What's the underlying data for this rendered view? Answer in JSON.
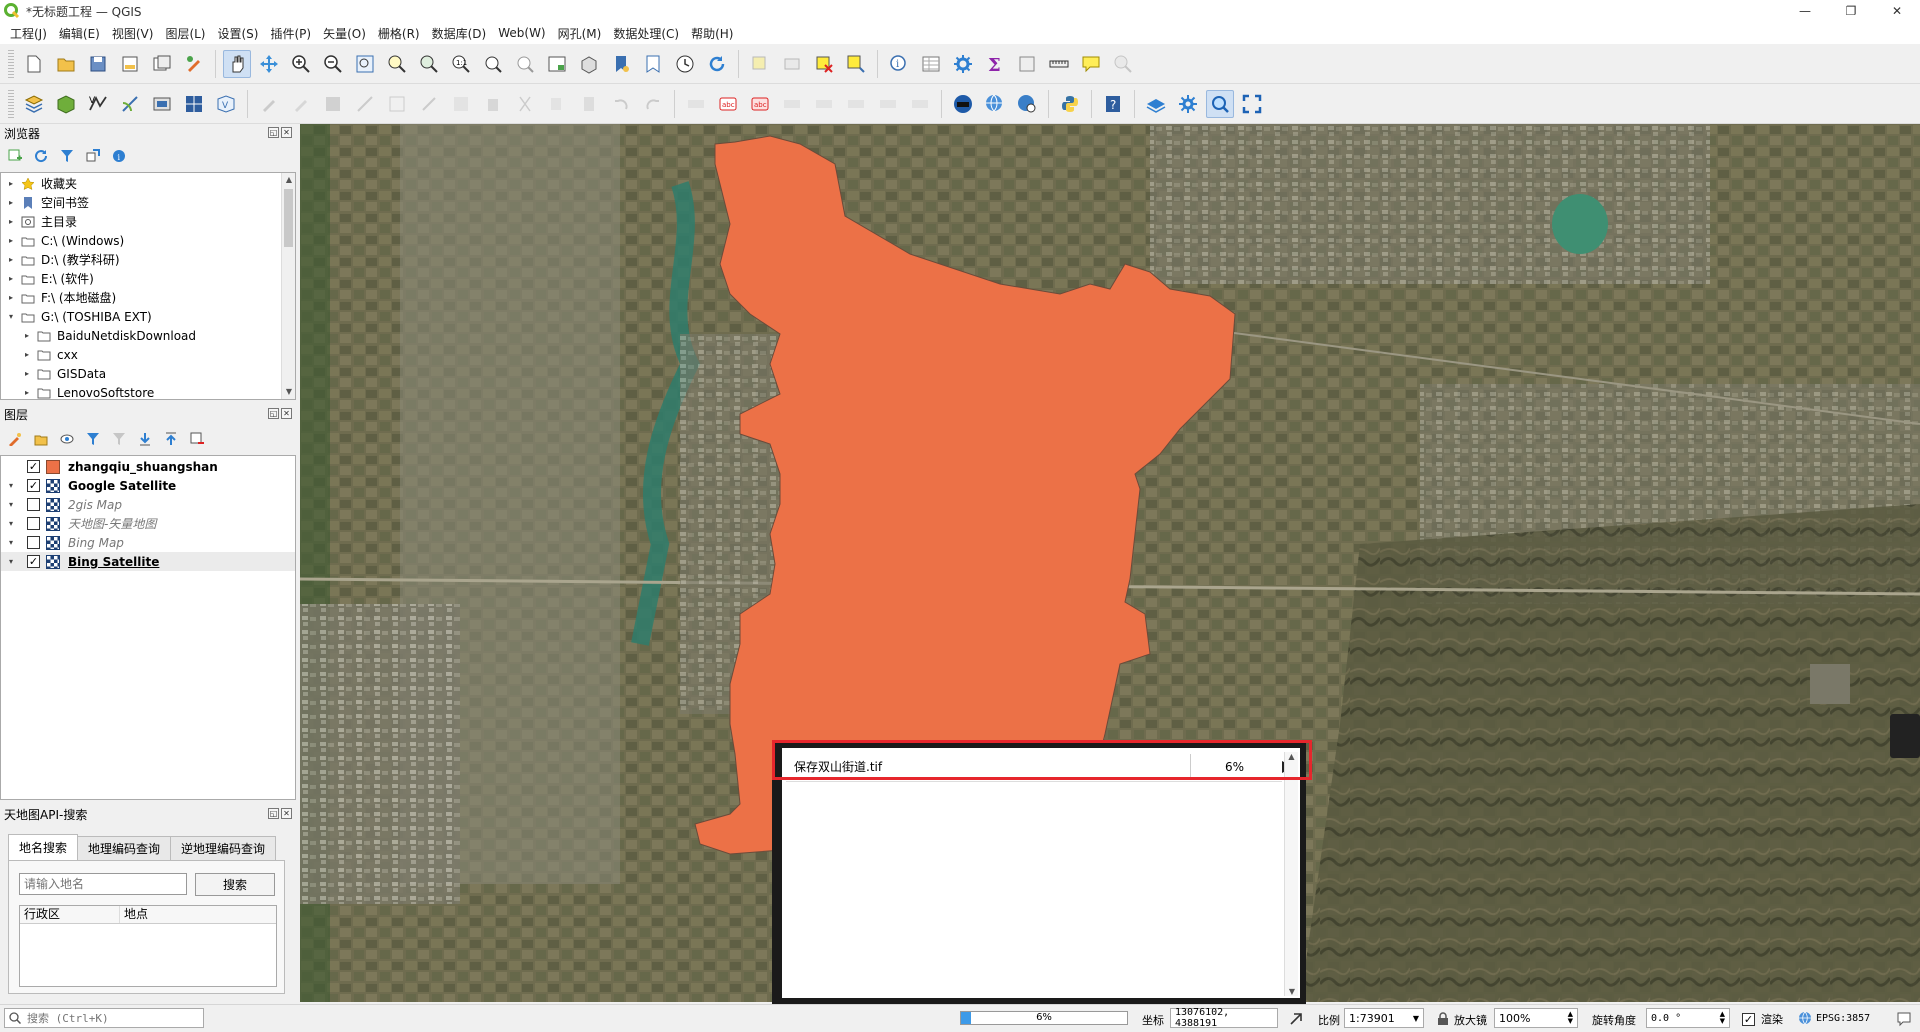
{
  "window": {
    "title": "*无标题工程 — QGIS"
  },
  "menu": [
    "工程(J)",
    "编辑(E)",
    "视图(V)",
    "图层(L)",
    "设置(S)",
    "插件(P)",
    "矢量(O)",
    "栅格(R)",
    "数据库(D)",
    "Web(W)",
    "网孔(M)",
    "数据处理(C)",
    "帮助(H)"
  ],
  "browser": {
    "title": "浏览器",
    "items": [
      {
        "label": "收藏夹",
        "icon": "star-icon",
        "indent": 0,
        "expanded": false
      },
      {
        "label": "空间书签",
        "icon": "bookmark-icon",
        "indent": 0,
        "expanded": false
      },
      {
        "label": "主目录",
        "icon": "home-folder-icon",
        "indent": 0,
        "expanded": false
      },
      {
        "label": "C:\\ (Windows)",
        "icon": "drive-icon",
        "indent": 0,
        "expanded": false
      },
      {
        "label": "D:\\ (教学科研)",
        "icon": "drive-icon",
        "indent": 0,
        "expanded": false
      },
      {
        "label": "E:\\ (软件)",
        "icon": "drive-icon",
        "indent": 0,
        "expanded": false
      },
      {
        "label": "F:\\ (本地磁盘)",
        "icon": "drive-icon",
        "indent": 0,
        "expanded": false
      },
      {
        "label": "G:\\ (TOSHIBA EXT)",
        "icon": "drive-icon",
        "indent": 0,
        "expanded": true
      },
      {
        "label": "BaiduNetdiskDownload",
        "icon": "folder-icon",
        "indent": 1,
        "expanded": false
      },
      {
        "label": "cxx",
        "icon": "folder-icon",
        "indent": 1,
        "expanded": false
      },
      {
        "label": "GISData",
        "icon": "folder-icon",
        "indent": 1,
        "expanded": false
      },
      {
        "label": "LenovoSoftstore",
        "icon": "folder-icon",
        "indent": 1,
        "expanded": false
      }
    ]
  },
  "layers": {
    "title": "图层",
    "items": [
      {
        "name": "zhangqiu_shuangshan",
        "checked": true,
        "type": "polygon",
        "bold": true,
        "italic": false,
        "underline": false
      },
      {
        "name": "Google Satellite",
        "checked": true,
        "type": "raster",
        "bold": true,
        "italic": false,
        "underline": false
      },
      {
        "name": "2gis Map",
        "checked": false,
        "type": "raster",
        "bold": false,
        "italic": true,
        "underline": false
      },
      {
        "name": "天地图-矢量地图",
        "checked": false,
        "type": "raster",
        "bold": false,
        "italic": true,
        "underline": false
      },
      {
        "name": "Bing Map",
        "checked": false,
        "type": "raster",
        "bold": false,
        "italic": true,
        "underline": false
      },
      {
        "name": "Bing Satellite",
        "checked": true,
        "type": "raster",
        "bold": true,
        "italic": false,
        "underline": true
      }
    ]
  },
  "tianditu": {
    "title": "天地图API-搜索",
    "tabs": [
      "地名搜索",
      "地理编码查询",
      "逆地理编码查询"
    ],
    "search_placeholder": "请输入地名",
    "search_button": "搜索",
    "columns": [
      "行政区",
      "地点"
    ]
  },
  "task": {
    "name": "保存双山街道.tif",
    "progress_text": "6%"
  },
  "status": {
    "search_placeholder": "搜索 (Ctrl+K)",
    "progress_text": "6%",
    "coord_label": "坐标",
    "coord_value": "13076102, 4388191",
    "scale_label": "比例",
    "scale_value": "1:73901",
    "magnifier_label": "放大镜",
    "magnifier_value": "100%",
    "rotation_label": "旋转角度",
    "rotation_value": "0.0 °",
    "render_label": "渲染",
    "crs": "EPSG:3857"
  },
  "colors": {
    "polygon_fill": "#ec7147",
    "highlight": "#e6262c"
  }
}
